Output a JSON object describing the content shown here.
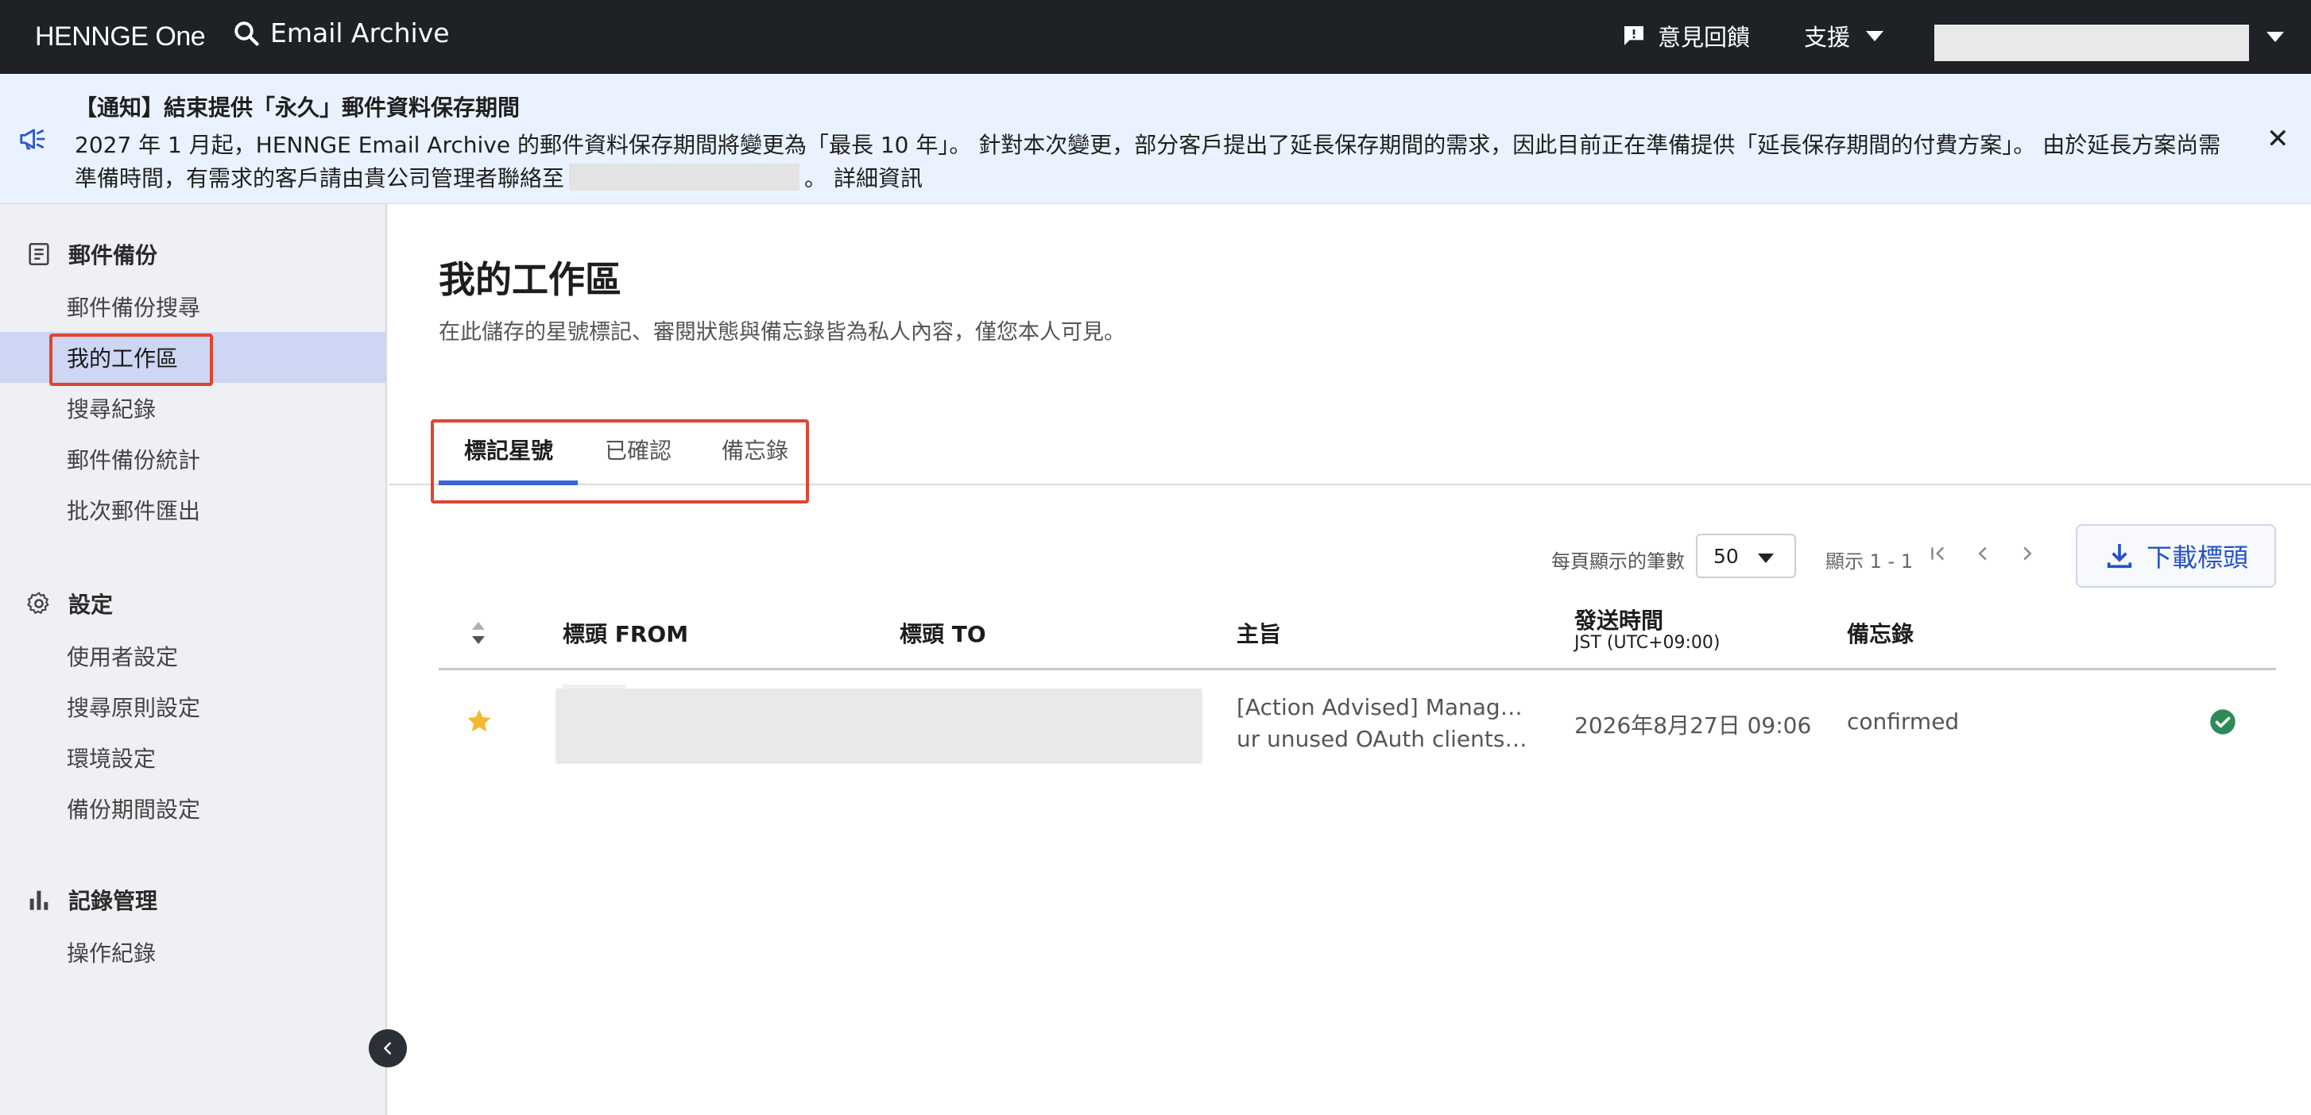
{
  "topbar": {
    "logo": "HENNGE One",
    "app_title": "Email Archive",
    "feedback_label": "意見回饋",
    "support_label": "支援"
  },
  "notice": {
    "title": "【通知】結束提供「永久」郵件資料保存期間",
    "body_part1": "2027 年 1 月起，HENNGE Email Archive 的郵件資料保存期間將變更為「最長 10 年」。 針對本次變更，部分客戶提出了延長保存期間的需求，因此目前正在準備提供「延長保存期間的付費方案」。 由於延長方案尚需準備時間，有需求的客戶請由貴公司管理者聯絡至",
    "body_part2": "。",
    "detail_link": "詳細資訊"
  },
  "sidebar": {
    "section_archive": "郵件備份",
    "archive_items": [
      "郵件備份搜尋",
      "我的工作區",
      "搜尋紀錄",
      "郵件備份統計",
      "批次郵件匯出"
    ],
    "section_settings": "設定",
    "settings_items": [
      "使用者設定",
      "搜尋原則設定",
      "環境設定",
      "備份期間設定"
    ],
    "section_logs": "記錄管理",
    "logs_items": [
      "操作紀錄"
    ]
  },
  "main": {
    "title": "我的工作區",
    "description": "在此儲存的星號標記、審閱狀態與備忘錄皆為私人內容，僅您本人可見。",
    "tabs": [
      "標記星號",
      "已確認",
      "備忘錄"
    ],
    "pager": {
      "per_page_label": "每頁顯示的筆數",
      "per_page_value": "50",
      "range": "顯示 1 - 1"
    },
    "download_label": "下載標頭",
    "columns": {
      "from": "標頭 FROM",
      "to": "標頭 TO",
      "subject": "主旨",
      "sent_time": "發送時間",
      "sent_time_tz": "JST (UTC+09:00)",
      "memo": "備忘錄"
    },
    "rows": [
      {
        "subject_line1": "[Action Advised] Manage yo",
        "subject_line2": "ur unused OAuth clients a…",
        "sent_time": "2026年8月27日 09:06",
        "memo": "confirmed"
      }
    ]
  },
  "colors": {
    "topbar": "#1e2126",
    "notice_bg": "#eaf2ff",
    "sidebar_bg": "#eff0f4",
    "active_item": "#cdd6f2",
    "accent": "#3a63d8",
    "highlight": "#e0452e",
    "star": "#f5b82e",
    "success": "#2e8b57"
  },
  "icons": [
    "search-icon",
    "feedback-icon",
    "chevron-down-icon",
    "megaphone-icon",
    "close-icon",
    "archive-icon",
    "gear-icon",
    "bar-chart-icon",
    "collapse-left-icon",
    "sort-icon",
    "star-icon",
    "first-page-icon",
    "prev-page-icon",
    "next-page-icon",
    "download-icon",
    "check-circle-icon"
  ]
}
